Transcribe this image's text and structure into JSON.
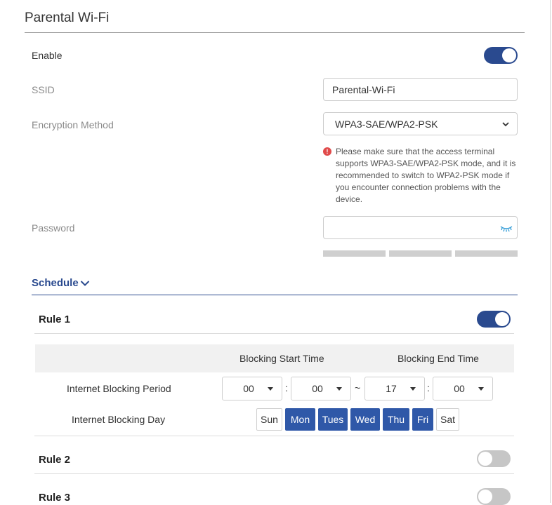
{
  "page": {
    "title": "Parental Wi-Fi"
  },
  "enable": {
    "label": "Enable",
    "on": true
  },
  "ssid": {
    "label": "SSID",
    "value": "Parental-Wi-Fi"
  },
  "encryption": {
    "label": "Encryption Method",
    "value": "WPA3-SAE/WPA2-PSK",
    "warning": "Please make sure that the access terminal supports WPA3-SAE/WPA2-PSK mode, and it is recommended to switch to WPA2-PSK mode if you encounter connection problems with the device."
  },
  "password": {
    "label": "Password",
    "value": ""
  },
  "schedule": {
    "label": "Schedule"
  },
  "rules": [
    {
      "title": "Rule 1",
      "on": true,
      "start_header": "Blocking Start Time",
      "end_header": "Blocking End Time",
      "period_label": "Internet Blocking Period",
      "day_label": "Internet Blocking Day",
      "start_hour": "00",
      "start_minute": "00",
      "end_hour": "17",
      "end_minute": "00",
      "time_separator": ":",
      "range_separator": "~",
      "days": [
        {
          "label": "Sun",
          "active": false
        },
        {
          "label": "Mon",
          "active": true
        },
        {
          "label": "Tues",
          "active": true
        },
        {
          "label": "Wed",
          "active": true
        },
        {
          "label": "Thu",
          "active": true
        },
        {
          "label": "Fri",
          "active": true
        },
        {
          "label": "Sat",
          "active": false
        }
      ]
    },
    {
      "title": "Rule 2",
      "on": false
    },
    {
      "title": "Rule 3",
      "on": false
    }
  ],
  "colors": {
    "accent": "#2a4a8f",
    "active_day": "#2f58a8",
    "toggle_off": "#c6c6c6",
    "warning": "#e04a4a"
  }
}
